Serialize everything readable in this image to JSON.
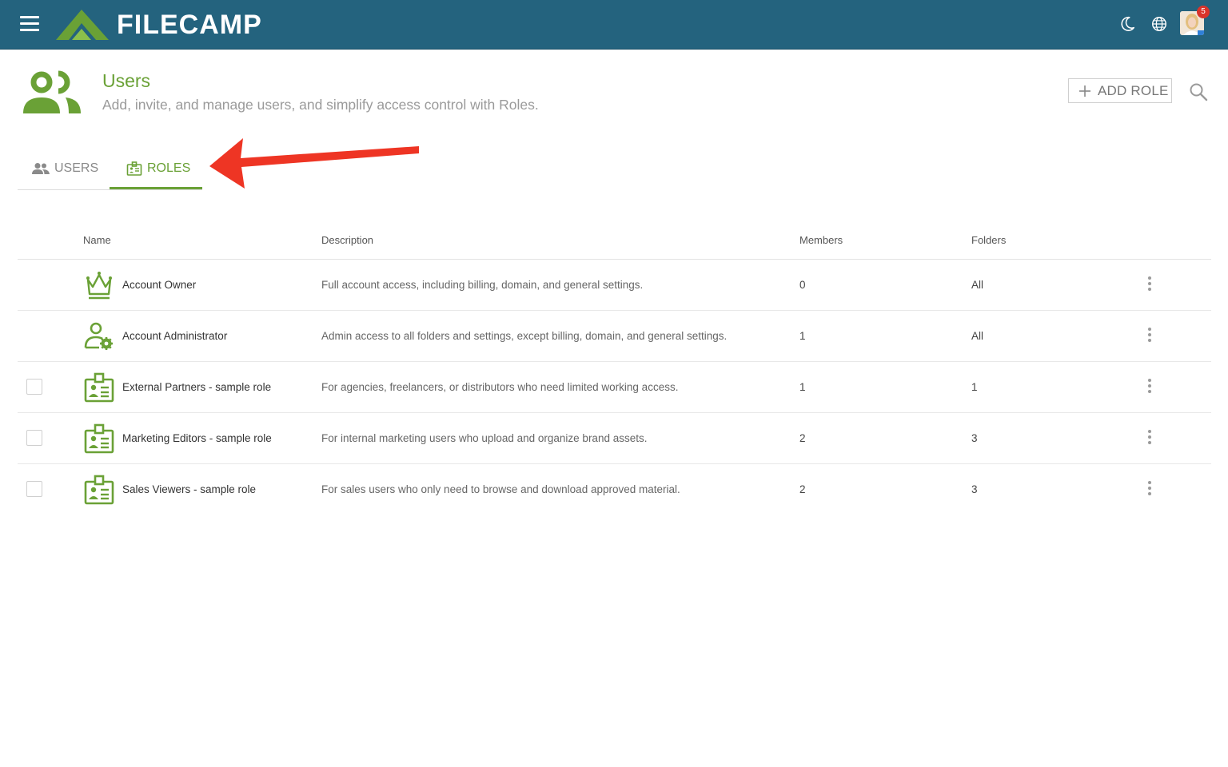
{
  "app": {
    "name": "FILECAMP",
    "notification_count": "5"
  },
  "header": {
    "title": "Users",
    "subtitle": "Add, invite, and manage users, and simplify access control with Roles.",
    "add_role_label": "ADD ROLE"
  },
  "tabs": [
    {
      "label": "USERS",
      "active": false
    },
    {
      "label": "ROLES",
      "active": true
    }
  ],
  "table": {
    "columns": {
      "name": "Name",
      "description": "Description",
      "members": "Members",
      "folders": "Folders"
    },
    "rows": [
      {
        "name": "Account Owner",
        "description": "Full account access, including billing, domain, and general settings.",
        "members": "0",
        "folders": "All",
        "icon": "crown-icon",
        "selectable": false
      },
      {
        "name": "Account Administrator",
        "description": "Admin access to all folders and settings, except billing, domain, and general settings.",
        "members": "1",
        "folders": "All",
        "icon": "user-gear-icon",
        "selectable": false
      },
      {
        "name": "External Partners - sample role",
        "description": "For agencies, freelancers, or distributors who need limited working access.",
        "members": "1",
        "folders": "1",
        "icon": "badge-icon",
        "selectable": true
      },
      {
        "name": "Marketing Editors - sample role",
        "description": "For internal marketing users who upload and organize brand assets.",
        "members": "2",
        "folders": "3",
        "icon": "badge-icon",
        "selectable": true
      },
      {
        "name": "Sales Viewers - sample role",
        "description": "For sales users who only need to browse and download approved material.",
        "members": "2",
        "folders": "3",
        "icon": "badge-icon",
        "selectable": true
      }
    ]
  },
  "colors": {
    "topbar": "#24637e",
    "accent_green": "#6aa136",
    "annotation_arrow": "#ee3524"
  }
}
